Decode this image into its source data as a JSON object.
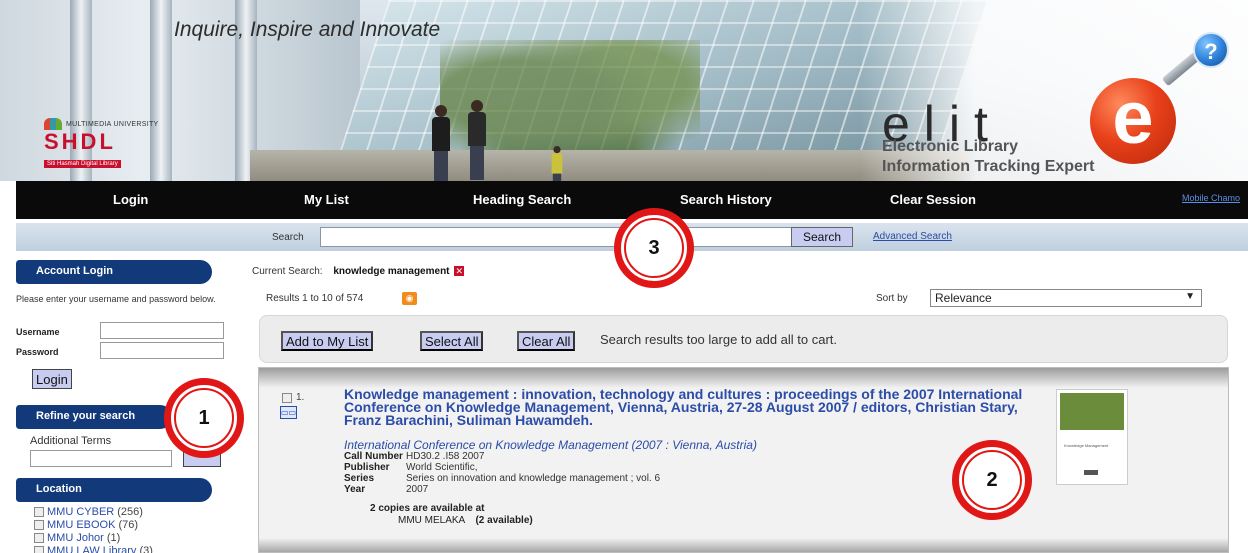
{
  "banner": {
    "tagline": "Inquire, Inspire and Innovate",
    "university_text": "MULTIMEDIA UNIVERSITY",
    "shdl": "SHDL",
    "shdl_sub": "Siti Hasmah Digital Library",
    "elite_word": "elit",
    "elite_letter": "e",
    "elite_line1": "Electronic Library",
    "elite_line2": "Information Tracking Expert",
    "help_symbol": "?",
    "accent_color": "#c8102e"
  },
  "nav": {
    "items": [
      {
        "label": "Login"
      },
      {
        "label": "My List"
      },
      {
        "label": "Heading Search"
      },
      {
        "label": "Search History"
      },
      {
        "label": "Clear Session"
      }
    ],
    "mobile_link": "Mobile Chamo"
  },
  "search": {
    "label": "Search",
    "value": "",
    "button": "Search",
    "advanced": "Advanced Search"
  },
  "sidebar": {
    "account_title": "Account Login",
    "account_desc": "Please enter your username and password below.",
    "username_label": "Username",
    "password_label": "Password",
    "login_button": "Login",
    "refine_title": "Refine your search",
    "additional_terms": "Additional Terms",
    "location_title": "Location",
    "locations": [
      {
        "name": "MMU CYBER",
        "count": "(256)"
      },
      {
        "name": "MMU EBOOK",
        "count": "(76)"
      },
      {
        "name": "MMU Johor",
        "count": "(1)"
      },
      {
        "name": "MMU LAW Library",
        "count": "(3)"
      }
    ]
  },
  "main": {
    "current_search_label": "Current Search:",
    "current_search_value": "knowledge management",
    "results_count": "Results 1 to 10 of 574",
    "sort_label": "Sort by",
    "sort_value": "Relevance",
    "cart": {
      "add_label": "Add to My List",
      "select_label": "Select All",
      "clear_label": "Clear All",
      "message": "Search results too large to add all to cart."
    },
    "result": {
      "number": "1.",
      "title": "Knowledge management : innovation, technology and cultures : proceedings of the 2007 International Conference on Knowledge Management, Vienna, Austria, 27-28 August 2007 / editors, Christian Stary, Franz Barachini, Suliman Hawamdeh.",
      "author": "International Conference on Knowledge Management (2007 : Vienna, Austria)",
      "meta": [
        {
          "key": "Call Number",
          "value": "HD30.2 .I58 2007"
        },
        {
          "key": "Publisher",
          "value": "World Scientific,"
        },
        {
          "key": "Series",
          "value": "Series on innovation and knowledge management ; vol. 6"
        },
        {
          "key": "Year",
          "value": "2007"
        }
      ],
      "copies": "2 copies are available at",
      "copies_location": "MMU MELAKA",
      "copies_status": "(2 available)",
      "cover_title": "Knowledge Management"
    }
  },
  "markers": [
    "1",
    "2",
    "3"
  ]
}
